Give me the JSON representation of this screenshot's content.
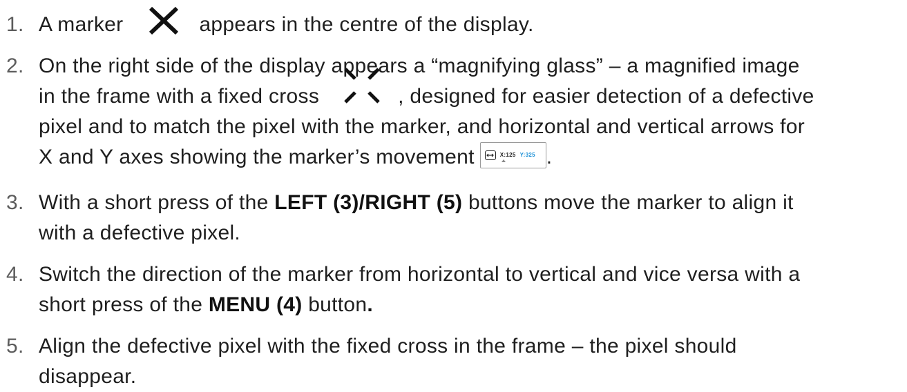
{
  "steps": [
    {
      "number": "1.",
      "part1": "A marker",
      "part2": "appears in the centre of the display."
    },
    {
      "number": "2.",
      "line1": "On the right side of the display appears a “magnifying glass” – a magnified image",
      "line2a": "in the frame with a fixed cross",
      "line2b": ", designed for easier detection of a defective",
      "line3": "pixel and to match the pixel with the marker, and horizontal and vertical arrows for",
      "line4": "X and Y axes showing the marker’s movement",
      "line4_end": ".",
      "coords": {
        "x": "X:125",
        "y": "Y:325"
      }
    },
    {
      "number": "3.",
      "line1a": "With a short press of the ",
      "line1b": "LEFT (3)/RIGHT (5)",
      "line1c": " buttons move the marker to align it",
      "line2": "with a defective pixel."
    },
    {
      "number": "4.",
      "line1": "Switch the direction of the marker from horizontal to vertical and vice versa with a",
      "line2a": "short press of the ",
      "line2b": "MENU (4)",
      "line2c": " button",
      "line2d": "."
    },
    {
      "number": "5.",
      "line1": "Align the defective pixel with the fixed cross in the frame – the pixel should",
      "line2": "disappear."
    }
  ],
  "icons": {
    "marker": "marker-x-icon",
    "fixed_cross": "fixed-cross-icon",
    "coordinates": "arrow-box-icon"
  },
  "colors": {
    "text": "#1f1f1f",
    "number": "#5c5c5c",
    "y_coordinate": "#1a8fd6"
  }
}
